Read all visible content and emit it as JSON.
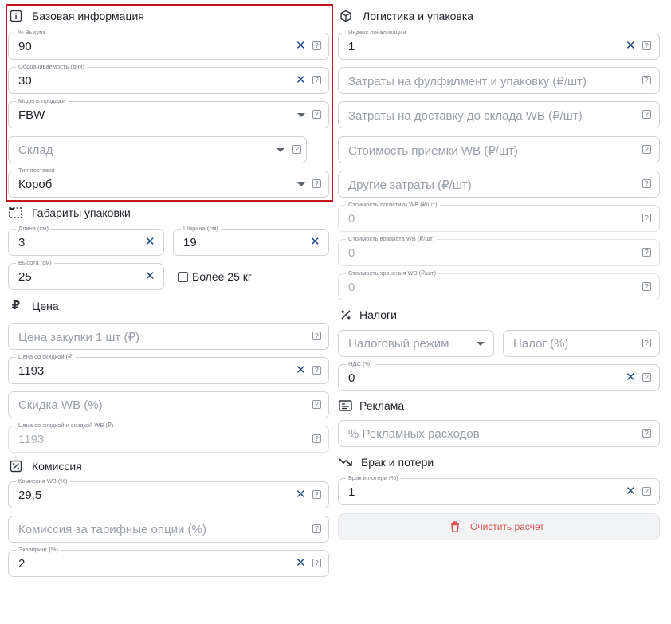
{
  "colors": {
    "highlight": "#c4161c",
    "clear_icon": "#1f4b85",
    "danger_text": "#d9534f"
  },
  "basic": {
    "title": "Базовая информация",
    "vykup": {
      "label": "% Выкупа",
      "value": "90"
    },
    "turnover": {
      "label": "Оборачиваемость (дни)",
      "value": "30"
    },
    "sale_model": {
      "label": "Модель продажи",
      "value": "FBW"
    },
    "warehouse": {
      "placeholder": "Склад"
    },
    "supply_type": {
      "label": "Тип поставки",
      "value": "Короб"
    }
  },
  "dimensions": {
    "title": "Габариты упаковки",
    "length": {
      "label": "Длина (см)",
      "value": "3"
    },
    "width": {
      "label": "Ширина (см)",
      "value": "19"
    },
    "height": {
      "label": "Высота (см)",
      "value": "25"
    },
    "over25": {
      "label": "Более 25 кг",
      "checked": false
    }
  },
  "price": {
    "title": "Цена",
    "purchase": {
      "placeholder": "Цена закупки 1 шт (₽)"
    },
    "discount_price": {
      "label": "Цена со скидкой (₽)",
      "value": "1193"
    },
    "wb_discount": {
      "placeholder": "Скидка WB (%)"
    },
    "final_price": {
      "label": "Цена со скидкой и скидкой WB (₽)",
      "value": "1193"
    }
  },
  "commission": {
    "title": "Комиссия",
    "wb": {
      "label": "Комиссия WB (%)",
      "value": "29,5"
    },
    "tariff": {
      "placeholder": "Комиссия за тарифные опции (%)"
    },
    "acquiring": {
      "label": "Эквайринг (%)",
      "value": "2"
    }
  },
  "logistics": {
    "title": "Логистика и упаковка",
    "index": {
      "label": "Индекс локализации",
      "value": "1"
    },
    "fulfillment": {
      "placeholder": "Затраты на фулфилмент и упаковку (₽/шт)"
    },
    "delivery": {
      "placeholder": "Затраты на доставку до склада WB (₽/шт)"
    },
    "acceptance": {
      "placeholder": "Стоимость приемки WB (₽/шт)"
    },
    "other": {
      "placeholder": "Другие затраты (₽/шт)"
    },
    "logistics_cost": {
      "label": "Стоимость логистики WB (₽/шт)",
      "value": "0"
    },
    "return_cost": {
      "label": "Стоимость возврата WB (₽/шт)",
      "value": "0"
    },
    "storage_cost": {
      "label": "Стоимость хранения WB (₽/шт)",
      "value": "0"
    }
  },
  "taxes": {
    "title": "Налоги",
    "regime": {
      "placeholder": "Налоговый режим"
    },
    "tax": {
      "placeholder": "Налог (%)"
    },
    "vat": {
      "label": "НДС (%)",
      "value": "0"
    }
  },
  "ads": {
    "title": "Реклама",
    "share": {
      "placeholder": "% Рекламных расходов"
    }
  },
  "defects": {
    "title": "Брак и потери",
    "value_field": {
      "label": "Брак и потери (%)",
      "value": "1"
    }
  },
  "actions": {
    "clear": "Очистить расчет"
  },
  "icons": {
    "info": "info-icon",
    "dimensions": "dashed-box-icon",
    "price": "ruble-icon",
    "commission": "percent-box-icon",
    "logistics": "box-3d-icon",
    "taxes": "percent-icon",
    "ads": "ad-card-icon",
    "defects": "trend-down-icon",
    "clear": "trash-icon",
    "help": "help-icon",
    "clear_field": "close-icon",
    "dropdown": "chevron-down-icon"
  }
}
